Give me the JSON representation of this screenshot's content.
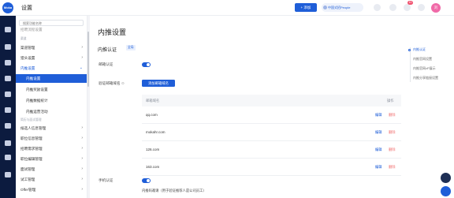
{
  "app": {
    "logo_text": "Moka",
    "title": "设置"
  },
  "topbar": {
    "add_label": "+ 添加",
    "company_label": "中国式招People",
    "badge_count": "10",
    "avatar_initial": "刘"
  },
  "menu": {
    "search_placeholder": "搜索功能名称",
    "top_cut_item": "招聘流程设置",
    "group_recruit": "渠道",
    "items_top": [
      "渠道管理",
      "猎头设置",
      "内推设置"
    ],
    "sub_items": [
      "内推设置",
      "内推奖励设置",
      "内推数据统计",
      "内推运营活动"
    ],
    "group_other": "简历与面试管理",
    "items_bottom": [
      "候选人信息管理",
      "职位信息管理",
      "招聘需求管理",
      "职位编辑管理",
      "面试管理",
      "试工管理",
      "Offer管理"
    ]
  },
  "main": {
    "page_title": "内推设置",
    "section_title": "内推认证",
    "section_tag": "全局",
    "label_email_auth": "邮箱认证",
    "label_email_domain": "验证邮箱域名",
    "add_domain_button": "添加邮箱域名",
    "table_header_domain": "邮箱域名",
    "table_header_action": "操作",
    "domains": [
      "qq.com",
      "mokahr.com",
      "126.com",
      "163.com"
    ],
    "edit_label": "编辑",
    "delete_label": "删除",
    "label_phone_auth": "手机认证",
    "label_invite_code": "内推码邀请（用于验证推荐人是公司员工）"
  },
  "anchor_nav": [
    "内推认证",
    "内推官网设置",
    "内推官网vP展示",
    "内推分享链接设置"
  ],
  "colors": {
    "primary": "#1f5ed8",
    "rail": "#0c1b3f",
    "danger": "#f06a6a",
    "avatar": "#f06aa8"
  }
}
